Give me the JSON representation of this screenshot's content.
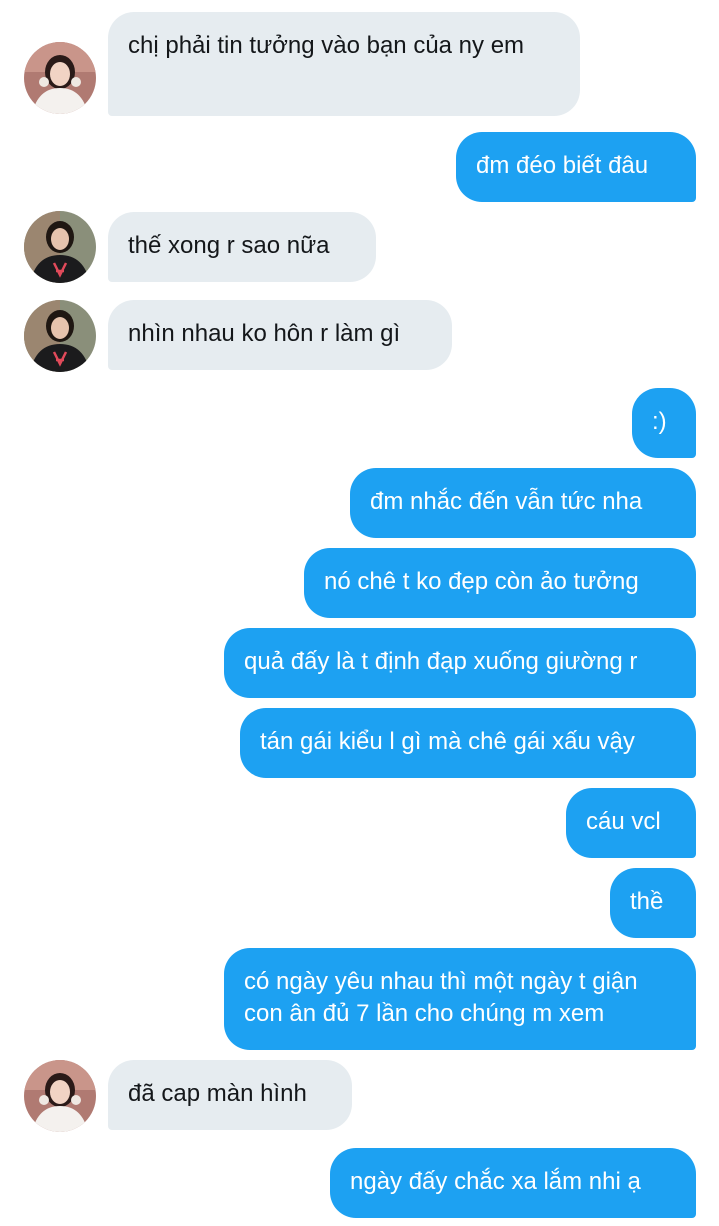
{
  "conversation": {
    "messages": [
      {
        "direction": "in",
        "text": "chị phải tin tưởng vào bạn của ny em",
        "avatar": "avatar-a"
      },
      {
        "direction": "out",
        "text": "đm đéo biết đâu"
      },
      {
        "direction": "in",
        "text": "thế xong r sao nữa",
        "avatar": "avatar-b"
      },
      {
        "direction": "in",
        "text": "nhìn nhau ko hôn r làm gì",
        "avatar": "avatar-b"
      },
      {
        "direction": "out",
        "text": ":)"
      },
      {
        "direction": "out",
        "text": "đm nhắc đến vẫn tức nha"
      },
      {
        "direction": "out",
        "text": "nó chê t ko đẹp còn ảo tưởng"
      },
      {
        "direction": "out",
        "text": "quả đấy là t định đạp xuống giường r"
      },
      {
        "direction": "out",
        "text": "tán gái kiểu l gì mà chê gái xấu vậy"
      },
      {
        "direction": "out",
        "text": "cáu vcl"
      },
      {
        "direction": "out",
        "text": "thề"
      },
      {
        "direction": "out",
        "text": "có ngày yêu nhau thì một ngày t giận con ân đủ 7 lần cho chúng m xem"
      },
      {
        "direction": "in",
        "text": "đã cap màn hình",
        "avatar": "avatar-a"
      },
      {
        "direction": "out",
        "text": "ngày đấy chắc xa lắm nhi ạ"
      }
    ]
  },
  "colors": {
    "incoming_bubble": "#e6ecf0",
    "incoming_text": "#14171a",
    "outgoing_bubble": "#1da1f2",
    "outgoing_text": "#ffffff"
  }
}
